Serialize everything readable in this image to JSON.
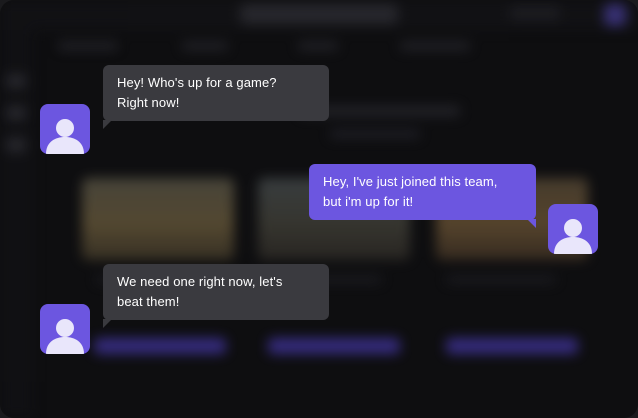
{
  "colors": {
    "accent": "#6c56e0",
    "incoming_bubble": "#3a3a3f",
    "background": "#0e0e10",
    "text": "#ffffff"
  },
  "chat": {
    "messages": [
      {
        "sender": "other",
        "lines": [
          "Hey! Who's up for a game?",
          "Right now!"
        ],
        "avatar_icon": "user-avatar-icon"
      },
      {
        "sender": "self",
        "lines": [
          "Hey, I've just joined this team,",
          "but i'm up for it!"
        ],
        "avatar_icon": "user-avatar-icon"
      },
      {
        "sender": "other",
        "lines": [
          "We need one right now, let's",
          "beat them!"
        ],
        "avatar_icon": "user-avatar-icon"
      }
    ]
  }
}
